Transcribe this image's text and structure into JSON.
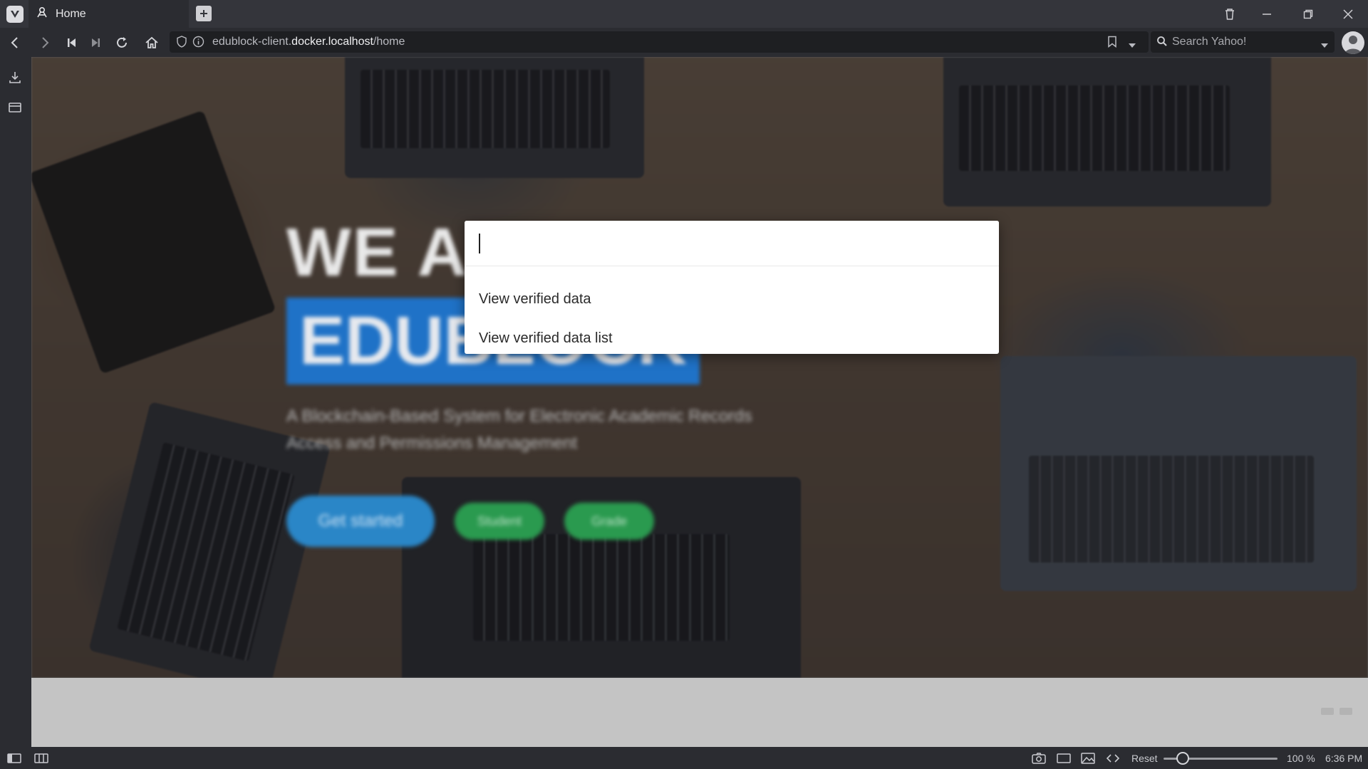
{
  "tab": {
    "title": "Home"
  },
  "address_bar": {
    "url_prefix": "edublock-client.",
    "url_domain": "docker.localhost",
    "url_path": "/home"
  },
  "search": {
    "placeholder": "Search Yahoo!"
  },
  "palette": {
    "input_value": "",
    "items": [
      "View verified data",
      "View verified data list"
    ]
  },
  "hero": {
    "line1": "WE A",
    "brand": "EDUBLOCK",
    "subtitle": "A Blockchain-Based System for Electronic Academic Records Access and Permissions Management",
    "buttons": {
      "start": "Get started",
      "student": "Student",
      "grade": "Grade"
    }
  },
  "statusbar": {
    "reset": "Reset",
    "zoom": "100 %",
    "time": "6:36 PM",
    "zoom_level": 0.17
  },
  "icons": [
    "vivaldi-icon",
    "tab-favicon-icon",
    "new-tab-icon",
    "trash-icon",
    "minimize-icon",
    "restore-icon",
    "close-icon",
    "back-icon",
    "forward-icon",
    "rewind-icon",
    "fast-forward-icon",
    "reload-icon",
    "home-icon",
    "shield-icon",
    "info-icon",
    "bookmark-icon",
    "dropdown-icon",
    "search-engine-icon",
    "profile-icon",
    "downloads-icon",
    "window-panel-icon",
    "panel-toggle-icon",
    "tiling-icon",
    "capture-icon",
    "window-icon",
    "image-icon",
    "page-actions-icon"
  ],
  "colors": {
    "brand_blue": "#1f72c7",
    "start_button": "#2a86c7",
    "green_button": "#2a9a4f"
  }
}
